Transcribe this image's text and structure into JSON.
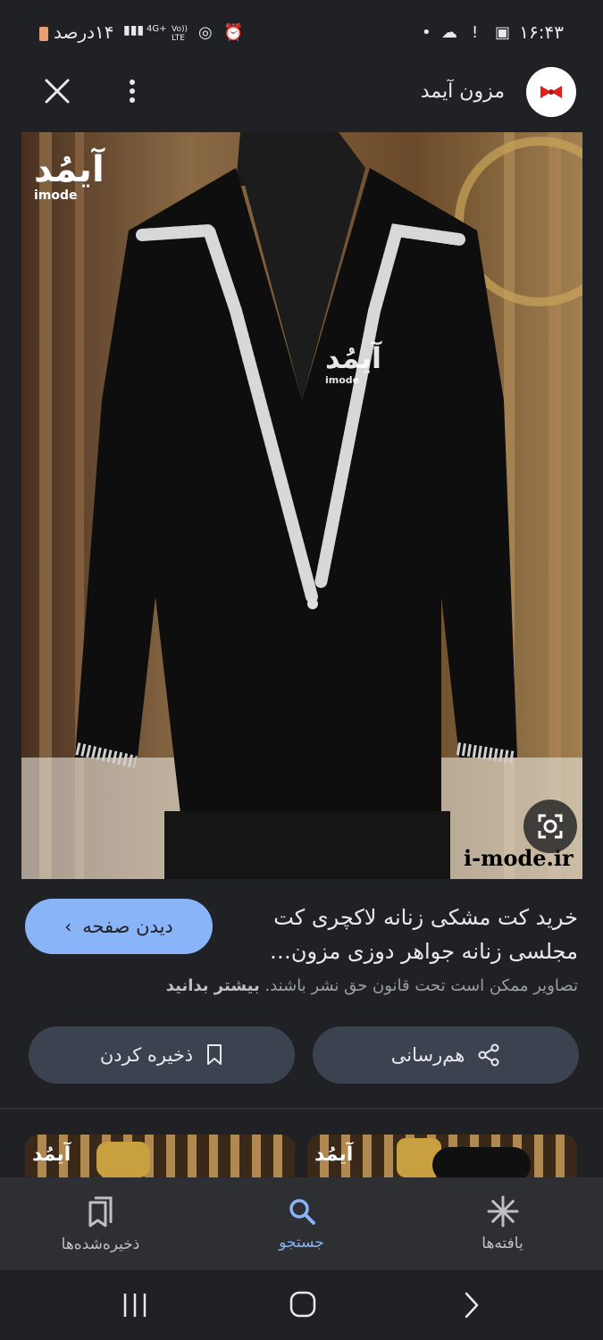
{
  "status_bar": {
    "time": "۱۶:۴۳",
    "battery_text": "۱۴درصد",
    "network_label": "4G+",
    "volte_label": "Vo)) LTE"
  },
  "header": {
    "site_name": "مزون آیمد"
  },
  "image": {
    "logo_text": "آیمُد",
    "logo_sub": "imode",
    "watermark_domain": "i-mode.ir"
  },
  "result": {
    "title": "خرید کت مشکی زنانه لاکچری کت مجلسی زنانه جواهر دوزی مزون…",
    "visit_label": "دیدن صفحه",
    "copyright_text": "تصاویر ممکن است تحت قانون حق نشر باشند.",
    "learn_more": "بیشتر بدانید",
    "share_label": "هم‌رسانی",
    "save_label": "ذخیره کردن"
  },
  "bottom_nav": {
    "items": [
      {
        "label": "یافته‌ها",
        "icon": "asterisk-icon"
      },
      {
        "label": "جستجو",
        "icon": "search-icon",
        "active": true
      },
      {
        "label": "ذخیره‌شده‌ها",
        "icon": "collections-icon"
      }
    ]
  },
  "colors": {
    "background": "#202124",
    "accent": "#8ab4f8",
    "pill": "#3c4350",
    "nav_bar": "#2d2f33"
  }
}
